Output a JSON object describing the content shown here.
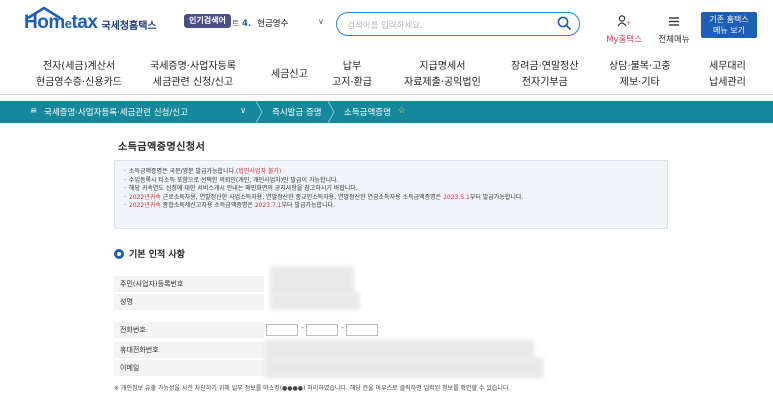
{
  "header": {
    "logo_main": "Hom",
    "logo_e": "e",
    "logo_tax": "tax",
    "logo_kr": "국세청홈택스",
    "popular_badge": "인기검색어",
    "popular_trail": "트",
    "popular_num": "4.",
    "popular_term": "현금영수",
    "search_placeholder": "검색어를 입력하세요.",
    "my_hometax": "My홈택스",
    "all_menu": "전체메뉴",
    "basic_btn_line1": "기존 홈택스",
    "basic_btn_line2": "메뉴 보기"
  },
  "nav": [
    {
      "line1": "전자(세금)계산서",
      "line2": "현금영수증·신용카드"
    },
    {
      "line1": "국세증명·사업자등록",
      "line2": "세금관련 신청/신고"
    },
    {
      "line1": "세금신고",
      "line2": ""
    },
    {
      "line1": "납부",
      "line2": "고지·환급"
    },
    {
      "line1": "지급명세서",
      "line2": "자료제출·공익법인"
    },
    {
      "line1": "장려금·연말정산",
      "line2": "전자기부금"
    },
    {
      "line1": "상담·불복·고충",
      "line2": "제보·기타"
    },
    {
      "line1": "세무대리",
      "line2": "납세관리"
    }
  ],
  "breadcrumb": {
    "menu_icon": "≡",
    "level1": "국세증명·사업자등록·세금관련 신청/신고",
    "level2": "즉시발급 증명",
    "level3": "소득금액증명",
    "star": "☆"
  },
  "page_title": "소득금액증명신청서",
  "notice": {
    "line1_a": "소득금액증명은 국문/영문 발급가능합니다.",
    "line1_b": "(법인사업자 불가)",
    "line2": "수입등록시 타소득 포함으로 선택한 의뢰인(개인, 개인사업자)만 발급이 가능합니다.",
    "line3": "해당 귀속연도 신청에 대한 서비스개시 안내는 메인화면의 공지사항을 참고하시기 바랍니다.",
    "line4_a": "2022년귀속",
    "line4_b": " 근로소득자용, 연말정산한 사업소득자용, 연말정산한 종교인소득자용, 연말정산한 연금소득자용 소득금액증명은 ",
    "line4_c": "2023.5.1",
    "line4_d": "부터 발급가능합니다.",
    "line5_a": "2022년귀속",
    "line5_b": " 종합소득세신고자용 소득금액증명은 ",
    "line5_c": "2023.7.1",
    "line5_d": "부터 발급가능합니다."
  },
  "section_title": "기본 인적 사항",
  "form": {
    "rrn_label": "주민(사업자)등록번호",
    "name_label": "성명",
    "phone_label": "전화번호",
    "mobile_label": "휴대전화번호",
    "email_label": "이메일",
    "dash": "-"
  },
  "footnote": "※ 개인정보 유출 가능성을 사전 차단하기 위해 일부 정보를 마스킹(●●●●) 처리하였습니다. 해당 칸을 마우스로 클릭하면 입력된 정보를 확인할 수 있습니다.",
  "colors": {
    "brand_blue": "#1d5fb4",
    "breadcrumb_teal": "#16889c",
    "accent_red": "#d3303a"
  }
}
